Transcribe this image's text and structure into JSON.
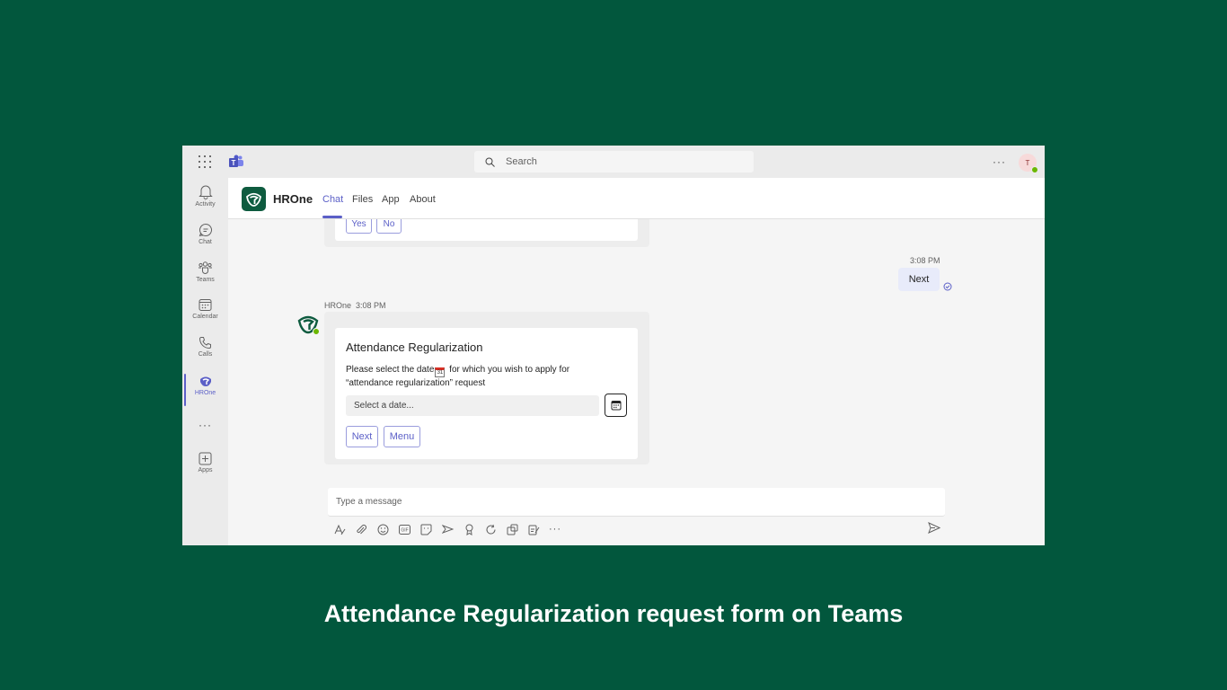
{
  "window": {
    "search_placeholder": "Search",
    "avatar_initial": "T",
    "more_label": "···"
  },
  "rail": {
    "items": [
      {
        "label": "Activity",
        "icon": "bell-icon"
      },
      {
        "label": "Chat",
        "icon": "chat-icon"
      },
      {
        "label": "Teams",
        "icon": "teams-icon"
      },
      {
        "label": "Calendar",
        "icon": "calendar-icon"
      },
      {
        "label": "Calls",
        "icon": "phone-icon"
      },
      {
        "label": "HROne",
        "icon": "hrone-icon"
      },
      {
        "label": "···",
        "icon": "more-icon"
      },
      {
        "label": "Apps",
        "icon": "add-apps-icon"
      }
    ]
  },
  "header": {
    "app_title": "HROne",
    "tabs": [
      "Chat",
      "Files",
      "App",
      "About"
    ]
  },
  "chat": {
    "prev_card_buttons": [
      "Yes",
      "No"
    ],
    "me_time": "3:08 PM",
    "me_message": "Next",
    "bot_name": "HROne",
    "bot_time": "3:08 PM",
    "card": {
      "title": "Attendance Regularization",
      "text_before": "Please select the date",
      "emoji_day": "31",
      "text_after": " for which you wish to apply for “attendance regularization” request",
      "date_placeholder": "Select a date...",
      "buttons": [
        "Next",
        "Menu"
      ]
    },
    "composer_placeholder": "Type a message"
  },
  "caption": "Attendance Regularization request form on Teams",
  "colors": {
    "background": "#02573d",
    "accent": "#5b5fc7",
    "status_online": "#6bb700"
  }
}
